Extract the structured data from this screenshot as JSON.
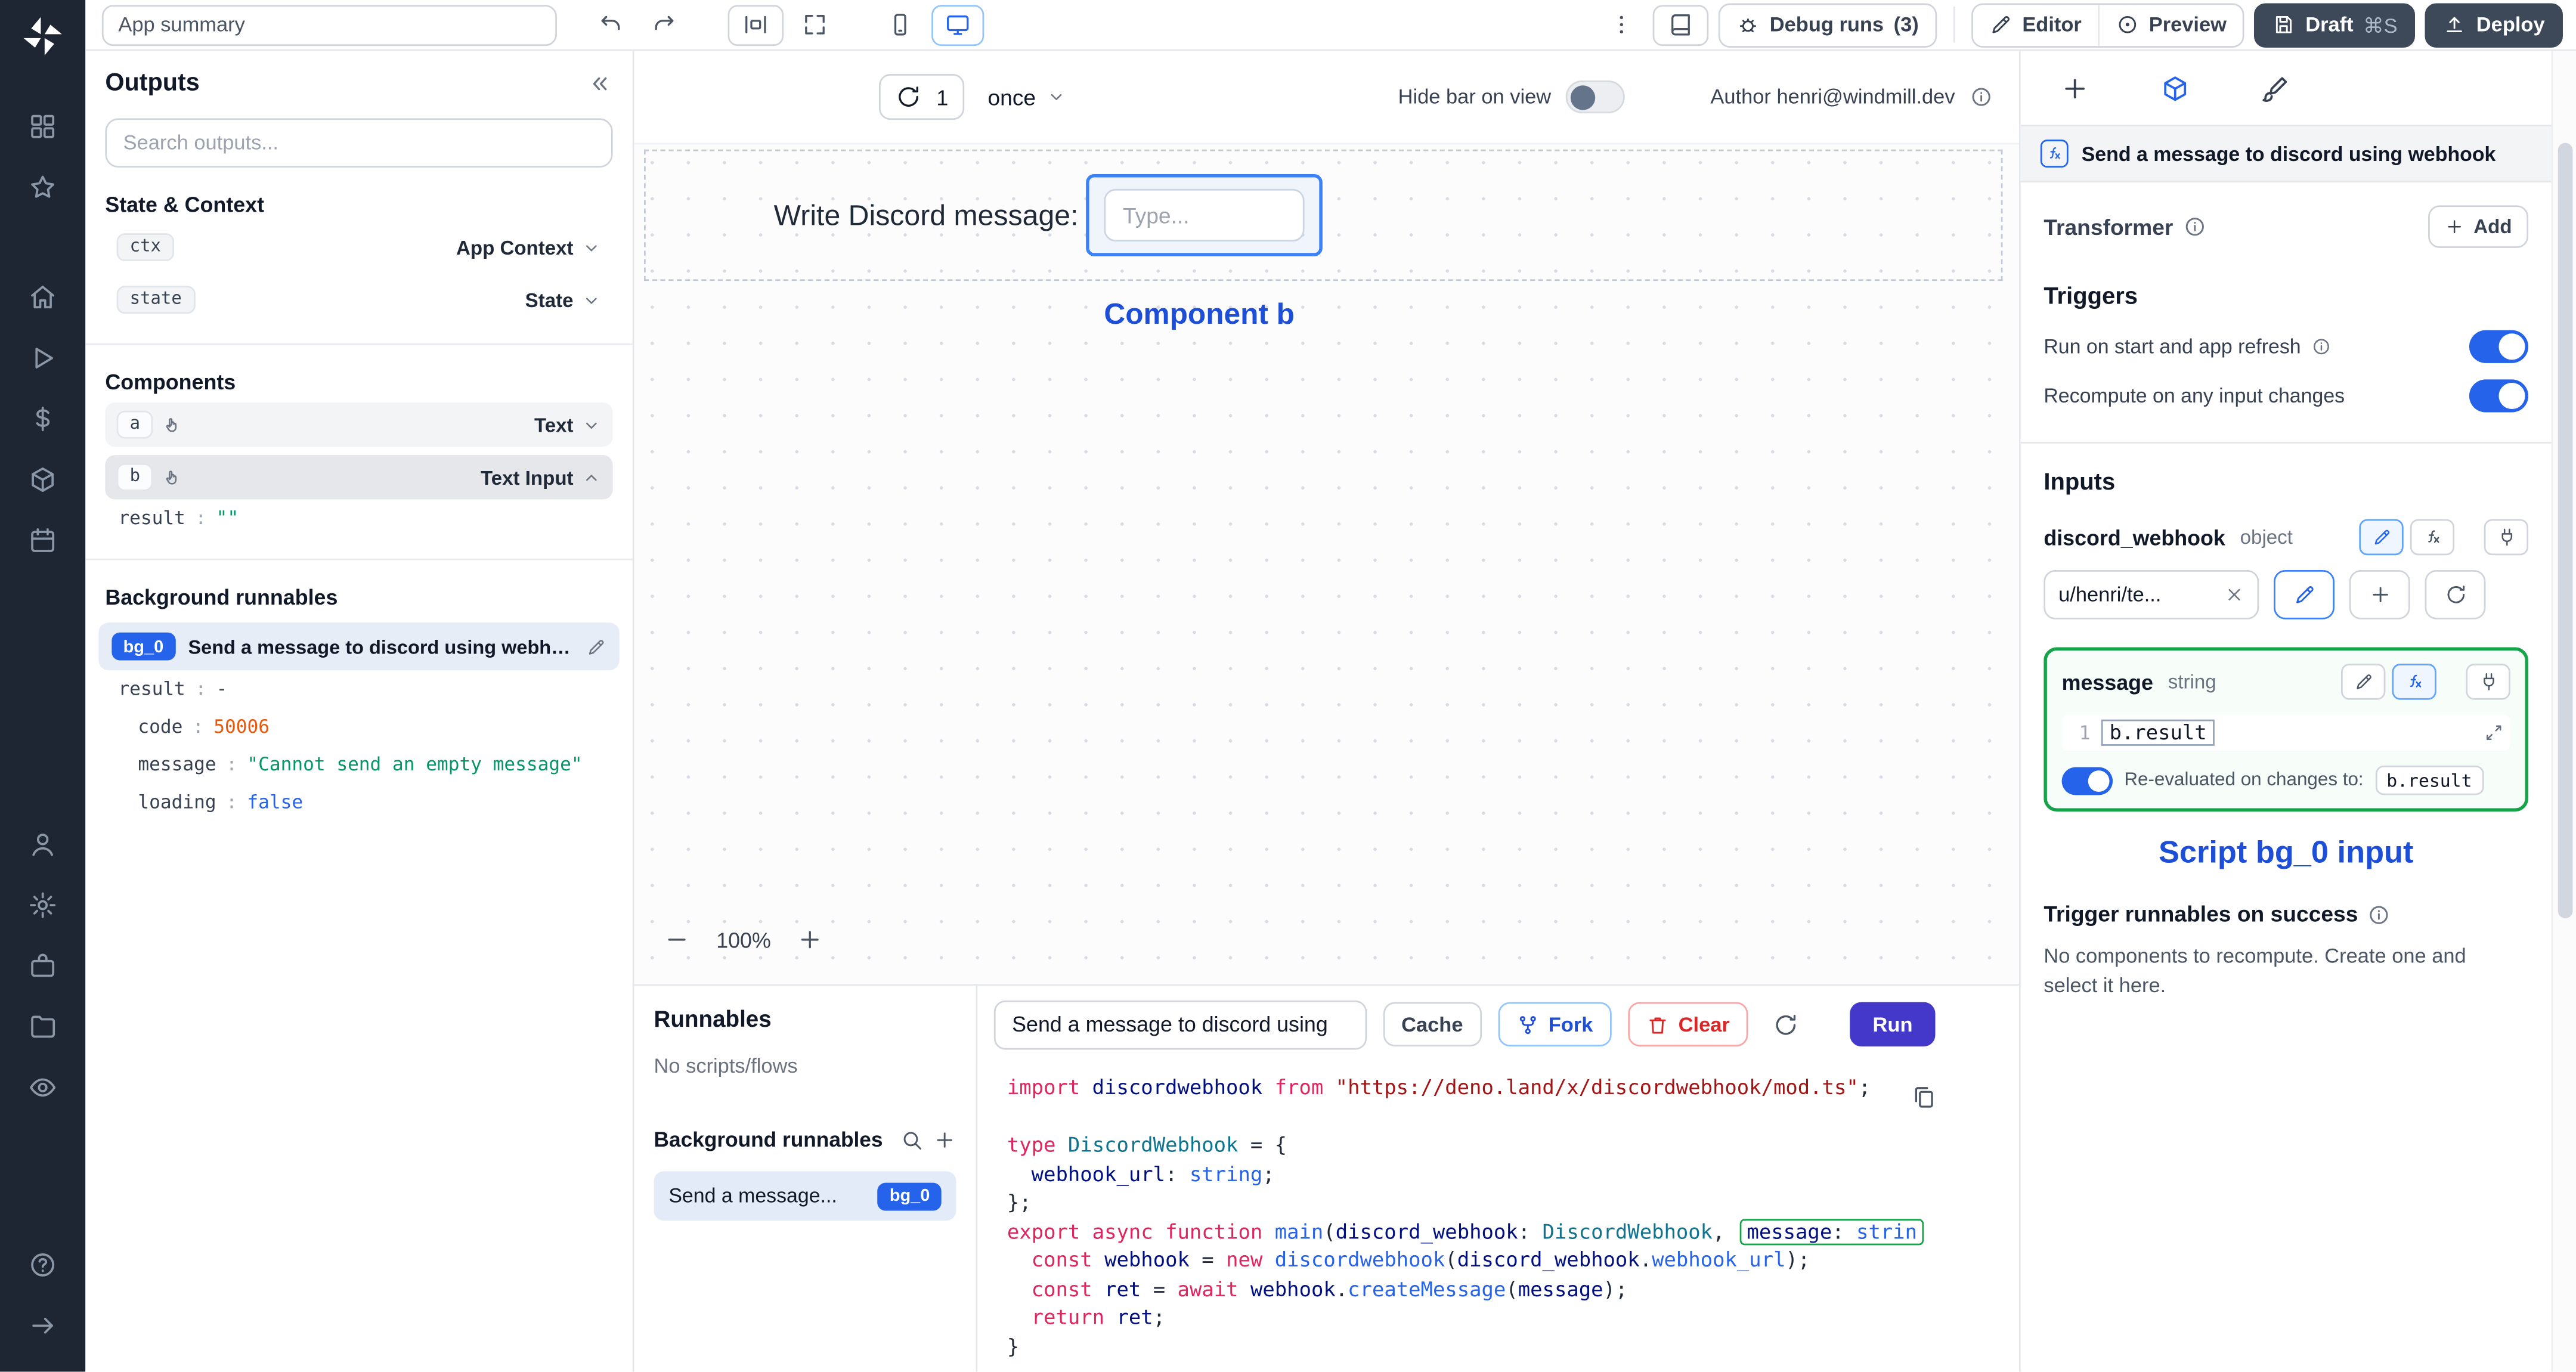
{
  "topbar": {
    "app_summary": "App summary",
    "debug_runs_label": "Debug runs",
    "debug_runs_count": "(3)",
    "editor_label": "Editor",
    "preview_label": "Preview",
    "draft_label": "Draft",
    "draft_shortcut": "⌘S",
    "deploy_label": "Deploy"
  },
  "outputs": {
    "title": "Outputs",
    "search_placeholder": "Search outputs...",
    "state_context_title": "State & Context",
    "ctx_badge": "ctx",
    "ctx_label": "App Context",
    "state_badge": "state",
    "state_label": "State",
    "components_title": "Components",
    "comp_a_badge": "a",
    "comp_a_label": "Text",
    "comp_b_badge": "b",
    "comp_b_label": "Text Input",
    "b_result_key": "result",
    "b_result_value": "\"\"",
    "bg_title": "Background runnables",
    "bg_badge": "bg_0",
    "bg_label": "Send a message to discord using webhook",
    "bg_fields": [
      {
        "key": "result",
        "value": "-"
      },
      {
        "key": "code",
        "value": "50006"
      },
      {
        "key": "message",
        "value": "\"Cannot send an empty message\""
      },
      {
        "key": "loading",
        "value": "false"
      }
    ]
  },
  "canvas": {
    "refresh_count": "1",
    "schedule": "once",
    "hide_bar_label": "Hide bar on view",
    "author": "Author henri@windmill.dev",
    "text_component": "Write Discord message:",
    "input_placeholder": "Type...",
    "annotation": "Component b",
    "zoom": "100%"
  },
  "runnables": {
    "title": "Runnables",
    "empty": "No scripts/flows",
    "bg_title": "Background runnables",
    "item_label": "Send a message...",
    "item_badge": "bg_0"
  },
  "code": {
    "script_title": "Send a message to discord using",
    "cache_label": "Cache",
    "fork_label": "Fork",
    "clear_label": "Clear",
    "run_label": "Run",
    "lines": [
      [
        {
          "c": "kw",
          "t": "import"
        },
        {
          "c": "pl",
          "t": " "
        },
        {
          "c": "var",
          "t": "discordwebhook"
        },
        {
          "c": "pl",
          "t": " "
        },
        {
          "c": "kw",
          "t": "from"
        },
        {
          "c": "pl",
          "t": " "
        },
        {
          "c": "str",
          "t": "\"https://deno.land/x/discordwebhook/mod.ts\""
        },
        {
          "c": "pl",
          "t": ";"
        }
      ],
      [],
      [
        {
          "c": "kw",
          "t": "type"
        },
        {
          "c": "pl",
          "t": " "
        },
        {
          "c": "type",
          "t": "DiscordWebhook"
        },
        {
          "c": "pl",
          "t": " = {"
        }
      ],
      [
        {
          "c": "pl",
          "t": "  "
        },
        {
          "c": "var",
          "t": "webhook_url"
        },
        {
          "c": "pl",
          "t": ": "
        },
        {
          "c": "blue",
          "t": "string"
        },
        {
          "c": "pl",
          "t": ";"
        }
      ],
      [
        {
          "c": "pl",
          "t": "};"
        }
      ],
      [
        {
          "c": "kw",
          "t": "export"
        },
        {
          "c": "pl",
          "t": " "
        },
        {
          "c": "kw",
          "t": "async"
        },
        {
          "c": "pl",
          "t": " "
        },
        {
          "c": "kw",
          "t": "function"
        },
        {
          "c": "pl",
          "t": " "
        },
        {
          "c": "fn",
          "t": "main"
        },
        {
          "c": "pl",
          "t": "("
        },
        {
          "c": "var",
          "t": "discord_webhook"
        },
        {
          "c": "pl",
          "t": ": "
        },
        {
          "c": "type",
          "t": "DiscordWebhook"
        },
        {
          "c": "pl",
          "t": ", "
        },
        {
          "box": [
            {
              "c": "var",
              "t": "message"
            },
            {
              "c": "pl",
              "t": ": "
            },
            {
              "c": "blue",
              "t": "strin"
            }
          ]
        }
      ],
      [
        {
          "c": "pl",
          "t": "  "
        },
        {
          "c": "kw",
          "t": "const"
        },
        {
          "c": "pl",
          "t": " "
        },
        {
          "c": "var",
          "t": "webhook"
        },
        {
          "c": "pl",
          "t": " = "
        },
        {
          "c": "kw",
          "t": "new"
        },
        {
          "c": "pl",
          "t": " "
        },
        {
          "c": "fn",
          "t": "discordwebhook"
        },
        {
          "c": "pl",
          "t": "("
        },
        {
          "c": "var",
          "t": "discord_webhook"
        },
        {
          "c": "pl",
          "t": "."
        },
        {
          "c": "blue",
          "t": "webhook_url"
        },
        {
          "c": "pl",
          "t": ");"
        }
      ],
      [
        {
          "c": "pl",
          "t": "  "
        },
        {
          "c": "kw",
          "t": "const"
        },
        {
          "c": "pl",
          "t": " "
        },
        {
          "c": "var",
          "t": "ret"
        },
        {
          "c": "pl",
          "t": " = "
        },
        {
          "c": "kw",
          "t": "await"
        },
        {
          "c": "pl",
          "t": " "
        },
        {
          "c": "var",
          "t": "webhook"
        },
        {
          "c": "pl",
          "t": "."
        },
        {
          "c": "fn",
          "t": "createMessage"
        },
        {
          "c": "pl",
          "t": "("
        },
        {
          "c": "var",
          "t": "message"
        },
        {
          "c": "pl",
          "t": ");"
        }
      ],
      [
        {
          "c": "pl",
          "t": "  "
        },
        {
          "c": "kw",
          "t": "return"
        },
        {
          "c": "pl",
          "t": " "
        },
        {
          "c": "var",
          "t": "ret"
        },
        {
          "c": "pl",
          "t": ";"
        }
      ],
      [
        {
          "c": "pl",
          "t": "}"
        }
      ]
    ]
  },
  "right": {
    "header": "Send a message to discord using webhook",
    "transformer_label": "Transformer",
    "add_label": "Add",
    "triggers_title": "Triggers",
    "trigger_run_on_start": "Run on start and app refresh",
    "trigger_recompute": "Recompute on any input changes",
    "inputs_title": "Inputs",
    "field1_name": "discord_webhook",
    "field1_type": "object",
    "field1_value": "u/henri/te...",
    "field2_name": "message",
    "field2_type": "string",
    "field2_gutter": "1",
    "field2_expr": "b.result",
    "reeval_label": "Re-evaluated on changes to:",
    "reeval_target": "b.result",
    "annotation": "Script bg_0 input",
    "success_title": "Trigger runnables on success",
    "success_hint": "No components to recompute. Create one and select it here."
  },
  "colors": {
    "accent_blue": "#2563eb",
    "annotation_blue": "#1d4ed8",
    "selection_green": "#16a34a",
    "dark_button": "#3d4959",
    "run_button": "#4338ca",
    "value_string_green": "#059669",
    "value_number_orange": "#ea580c",
    "keyword_red": "#e0245e",
    "string_maroon": "#a31515"
  }
}
